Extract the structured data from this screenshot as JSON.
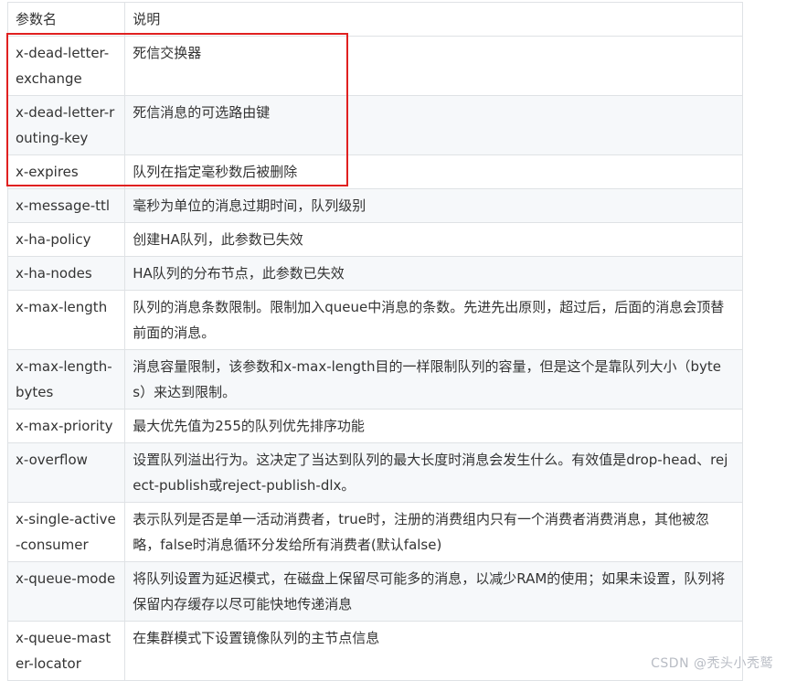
{
  "table": {
    "headers": {
      "name": "参数名",
      "description": "说明"
    },
    "rows": [
      {
        "name": "x-dead-letter-exchange",
        "description": "死信交换器"
      },
      {
        "name": "x-dead-letter-routing-key",
        "description": "死信消息的可选路由键"
      },
      {
        "name": "x-expires",
        "description": "队列在指定毫秒数后被删除"
      },
      {
        "name": "x-message-ttl",
        "description": "毫秒为单位的消息过期时间，队列级别"
      },
      {
        "name": "x-ha-policy",
        "description": "创建HA队列，此参数已失效"
      },
      {
        "name": "x-ha-nodes",
        "description": "HA队列的分布节点，此参数已失效"
      },
      {
        "name": "x-max-length",
        "description": "队列的消息条数限制。限制加入queue中消息的条数。先进先出原则，超过后，后面的消息会顶替前面的消息。"
      },
      {
        "name": "x-max-length-bytes",
        "description": "消息容量限制，该参数和x-max-length目的一样限制队列的容量，但是这个是靠队列大小（bytes）来达到限制。"
      },
      {
        "name": "x-max-priority",
        "description": "最大优先值为255的队列优先排序功能"
      },
      {
        "name": "x-overflow",
        "description": "设置队列溢出行为。这决定了当达到队列的最大长度时消息会发生什么。有效值是drop-head、reject-publish或reject-publish-dlx。"
      },
      {
        "name": "x-single-active-consumer",
        "description": "表示队列是否是单一活动消费者，true时，注册的消费组内只有一个消费者消费消息，其他被忽略，false时消息循环分发给所有消费者(默认false)"
      },
      {
        "name": "x-queue-mode",
        "description": "将队列设置为延迟模式，在磁盘上保留尽可能多的消息，以减少RAM的使用；如果未设置，队列将保留内存缓存以尽可能快地传递消息"
      },
      {
        "name": "x-queue-master-locator",
        "description": "在集群模式下设置镜像队列的主节点信息"
      }
    ]
  },
  "annotation": {
    "highlight_color": "#e02020"
  },
  "watermark": {
    "text": "CSDN @秃头小秃鹫"
  }
}
